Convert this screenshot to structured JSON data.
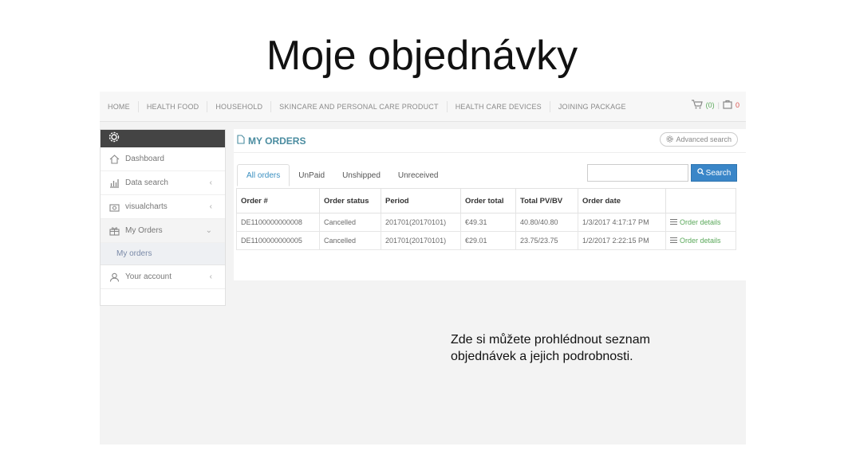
{
  "slide": {
    "title": "Moje objednávky",
    "caption_line1": "Zde si můžete prohlédnout seznam",
    "caption_line2": "objednávek a jejich podrobnosti."
  },
  "topnav": {
    "items": [
      "HOME",
      "HEALTH FOOD",
      "HOUSEHOLD",
      "SKINCARE AND PERSONAL CARE PRODUCT",
      "HEALTH CARE DEVICES",
      "JOINING PACKAGE"
    ],
    "cart_count": "(0)",
    "bag_count": "0"
  },
  "sidebar": {
    "items": [
      {
        "label": "Dashboard",
        "icon": "home-icon"
      },
      {
        "label": "Data search",
        "icon": "bar-chart-icon"
      },
      {
        "label": "visualcharts",
        "icon": "camera-icon"
      },
      {
        "label": "My Orders",
        "icon": "gift-icon"
      },
      {
        "label": "My orders",
        "icon": ""
      },
      {
        "label": "Your account",
        "icon": "user-icon"
      }
    ]
  },
  "main": {
    "title": "MY ORDERS",
    "advanced_search": "Advanced search",
    "tabs": [
      "All orders",
      "UnPaid",
      "Unshipped",
      "Unreceived"
    ],
    "search_placeholder": "",
    "search_button": "Search",
    "table": {
      "headers": [
        "Order #",
        "Order status",
        "Period",
        "Order total",
        "Total PV/BV",
        "Order date",
        ""
      ],
      "rows": [
        [
          "DE1100000000008",
          "Cancelled",
          "201701(20170101)",
          "€49.31",
          "40.80/40.80",
          "1/3/2017 4:17:17 PM",
          "Order details"
        ],
        [
          "DE1100000000005",
          "Cancelled",
          "201701(20170101)",
          "€29.01",
          "23.75/23.75",
          "1/2/2017 2:22:15 PM",
          "Order details"
        ]
      ]
    }
  }
}
